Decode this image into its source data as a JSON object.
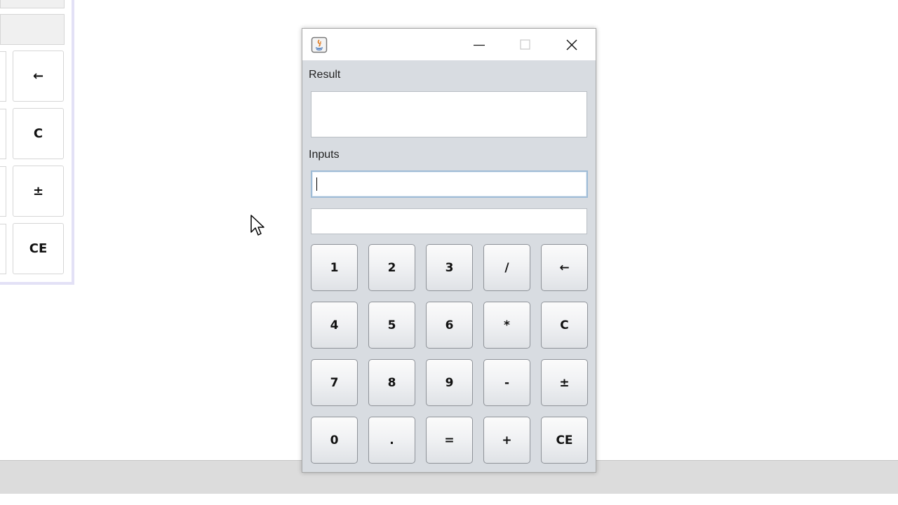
{
  "background": {
    "buttons": [
      "←",
      "C",
      "±",
      "CE"
    ]
  },
  "window": {
    "title": "",
    "app_icon": "java-icon",
    "controls": [
      "minimize-icon",
      "maximize-icon",
      "close-icon"
    ]
  },
  "calculator": {
    "result_label": "Result",
    "result_value": "",
    "inputs_label": "Inputs",
    "input1_value": "",
    "input2_value": "",
    "keys": [
      {
        "label": "1",
        "name": "key-1"
      },
      {
        "label": "2",
        "name": "key-2"
      },
      {
        "label": "3",
        "name": "key-3"
      },
      {
        "label": "/",
        "name": "key-divide"
      },
      {
        "label": "←",
        "name": "key-backspace"
      },
      {
        "label": "4",
        "name": "key-4"
      },
      {
        "label": "5",
        "name": "key-5"
      },
      {
        "label": "6",
        "name": "key-6"
      },
      {
        "label": "*",
        "name": "key-multiply"
      },
      {
        "label": "C",
        "name": "key-clear"
      },
      {
        "label": "7",
        "name": "key-7"
      },
      {
        "label": "8",
        "name": "key-8"
      },
      {
        "label": "9",
        "name": "key-9"
      },
      {
        "label": "-",
        "name": "key-subtract"
      },
      {
        "label": "±",
        "name": "key-negate"
      },
      {
        "label": "0",
        "name": "key-0"
      },
      {
        "label": ".",
        "name": "key-decimal"
      },
      {
        "label": "=",
        "name": "key-equals"
      },
      {
        "label": "+",
        "name": "key-add"
      },
      {
        "label": "CE",
        "name": "key-clear-entry"
      }
    ]
  },
  "colors": {
    "window_bg": "#d8dce1",
    "focus_border": "#9fbcd6"
  }
}
